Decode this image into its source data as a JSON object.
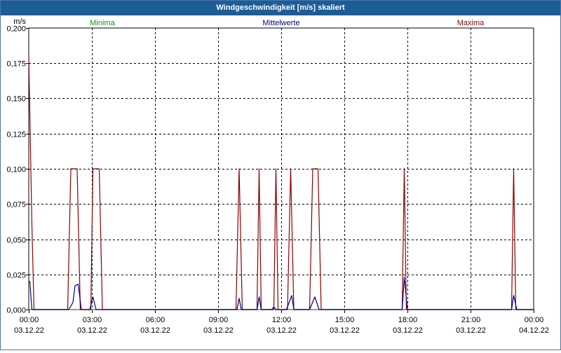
{
  "window": {
    "title": "Windgeschwindigkeit [m/s] skaliert"
  },
  "chart_data": {
    "type": "line",
    "title": "Windgeschwindigkeit [m/s] skaliert",
    "ylabel": "m/s",
    "ylim": [
      0,
      0.2
    ],
    "xlim_hours": [
      0,
      24
    ],
    "yticks": [
      "0,000",
      "0,025",
      "0,050",
      "0,075",
      "0,100",
      "0,125",
      "0,150",
      "0,175",
      "0,200"
    ],
    "xticks": [
      {
        "time": "00:00",
        "date": "03.12.22"
      },
      {
        "time": "03:00",
        "date": "03.12.22"
      },
      {
        "time": "06:00",
        "date": "03.12.22"
      },
      {
        "time": "09:00",
        "date": "03.12.22"
      },
      {
        "time": "12:00",
        "date": "03.12.22"
      },
      {
        "time": "15:00",
        "date": "03.12.22"
      },
      {
        "time": "18:00",
        "date": "03.12.22"
      },
      {
        "time": "21:00",
        "date": "03.12.22"
      },
      {
        "time": "00:00",
        "date": "04.12.22"
      }
    ],
    "grid": true,
    "legend_position": "top",
    "series": [
      {
        "name": "Minima",
        "color": "#00a000",
        "x": [
          0,
          24
        ],
        "values": [
          0,
          0
        ]
      },
      {
        "name": "Mittelwerte",
        "color": "#00008b",
        "x": [
          0,
          0.05,
          0.15,
          1.9,
          2.1,
          2.2,
          2.35,
          2.5,
          2.9,
          3.05,
          3.2,
          3.35,
          9.9,
          10.0,
          10.1,
          10.85,
          10.95,
          11.05,
          11.55,
          11.65,
          11.75,
          12.25,
          12.5,
          12.6,
          13.35,
          13.6,
          13.8,
          17.75,
          17.85,
          18.0,
          22.95,
          23.05,
          23.2,
          24
        ],
        "values": [
          0.02,
          0.02,
          0,
          0,
          0.005,
          0.017,
          0.018,
          0,
          0,
          0.009,
          0,
          0,
          0,
          0.008,
          0,
          0,
          0.009,
          0,
          0,
          0.002,
          0,
          0,
          0.01,
          0,
          0,
          0.009,
          0,
          0,
          0.023,
          0,
          0,
          0.01,
          0,
          0
        ]
      },
      {
        "name": "Maxima",
        "color": "#8b0000",
        "x": [
          0,
          0.05,
          0.15,
          0.25,
          1.85,
          2.0,
          2.3,
          2.45,
          2.95,
          3.05,
          3.35,
          3.5,
          9.85,
          10.0,
          10.15,
          10.85,
          10.95,
          11.05,
          11.65,
          11.75,
          11.85,
          12.3,
          12.45,
          12.6,
          13.35,
          13.5,
          13.75,
          13.9,
          17.75,
          17.85,
          17.95,
          22.95,
          23.05,
          23.15,
          24
        ],
        "values": [
          0.18,
          0.14,
          0.06,
          0,
          0,
          0.1,
          0.1,
          0,
          0,
          0.1,
          0.1,
          0,
          0,
          0.1,
          0,
          0,
          0.1,
          0,
          0,
          0.1,
          0,
          0,
          0.1,
          0,
          0,
          0.1,
          0.1,
          0,
          0,
          0.1,
          0,
          0,
          0.1,
          0,
          0
        ]
      }
    ]
  }
}
